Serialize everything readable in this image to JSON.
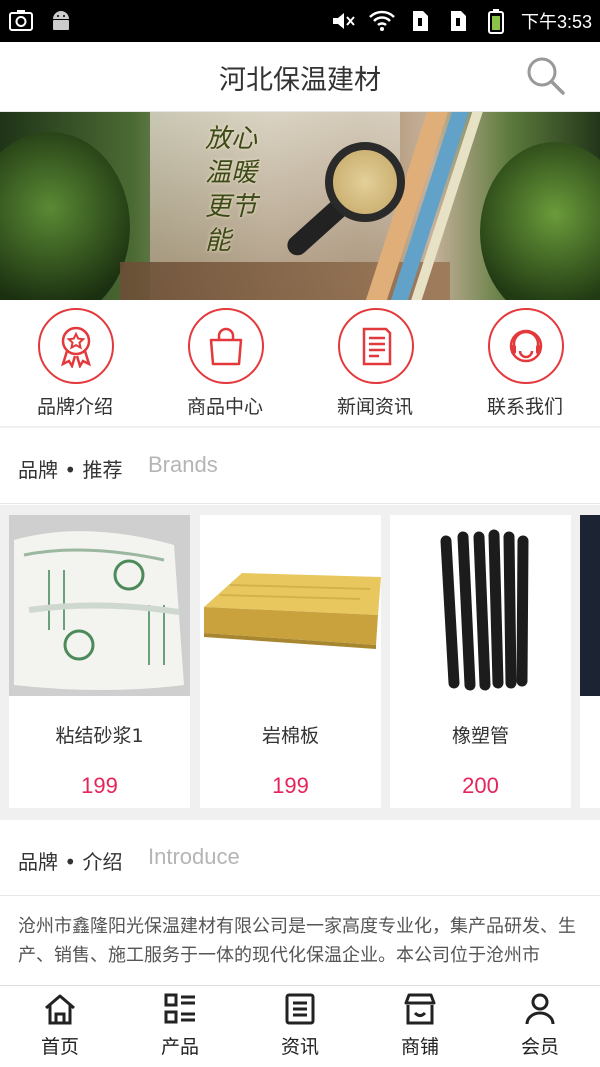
{
  "status_bar": {
    "time": "下午3:53",
    "icons": [
      "screenshot-icon",
      "android-icon",
      "mute-icon",
      "wifi-icon",
      "sim1-icon",
      "sim2-icon",
      "battery-icon"
    ]
  },
  "header": {
    "title": "河北保温建材",
    "search_icon": "search-icon"
  },
  "banner": {
    "slogan": [
      "放心",
      "温暖",
      "更节能"
    ],
    "active_dot_color": "#e5242b"
  },
  "quick_nav": [
    {
      "label": "品牌介绍",
      "icon": "award-icon"
    },
    {
      "label": "商品中心",
      "icon": "shopping-bag-icon"
    },
    {
      "label": "新闻资讯",
      "icon": "news-icon"
    },
    {
      "label": "联系我们",
      "icon": "headset-icon"
    }
  ],
  "brands_section": {
    "title_cn": "品牌 • 推荐",
    "title_en": "Brands"
  },
  "products": [
    {
      "name": "粘结砂浆1",
      "price": "199"
    },
    {
      "name": "岩棉板",
      "price": "199"
    },
    {
      "name": "橡塑管",
      "price": "200"
    }
  ],
  "intro_section": {
    "title_cn": "品牌 • 介绍",
    "title_en": "Introduce",
    "text": "沧州市鑫隆阳光保温建材有限公司是一家高度专业化，集产品研发、生产、销售、施工服务于一体的现代化保温企业。本公司位于沧州市"
  },
  "tab_bar": [
    {
      "label": "首页",
      "icon": "home-icon"
    },
    {
      "label": "产品",
      "icon": "product-list-icon"
    },
    {
      "label": "资讯",
      "icon": "news-icon"
    },
    {
      "label": "商铺",
      "icon": "shop-icon"
    },
    {
      "label": "会员",
      "icon": "user-icon"
    }
  ],
  "colors": {
    "accent": "#e4393c",
    "price": "#e4245b",
    "status_bar": "#000000",
    "section_gap": "#f0f0f0"
  }
}
